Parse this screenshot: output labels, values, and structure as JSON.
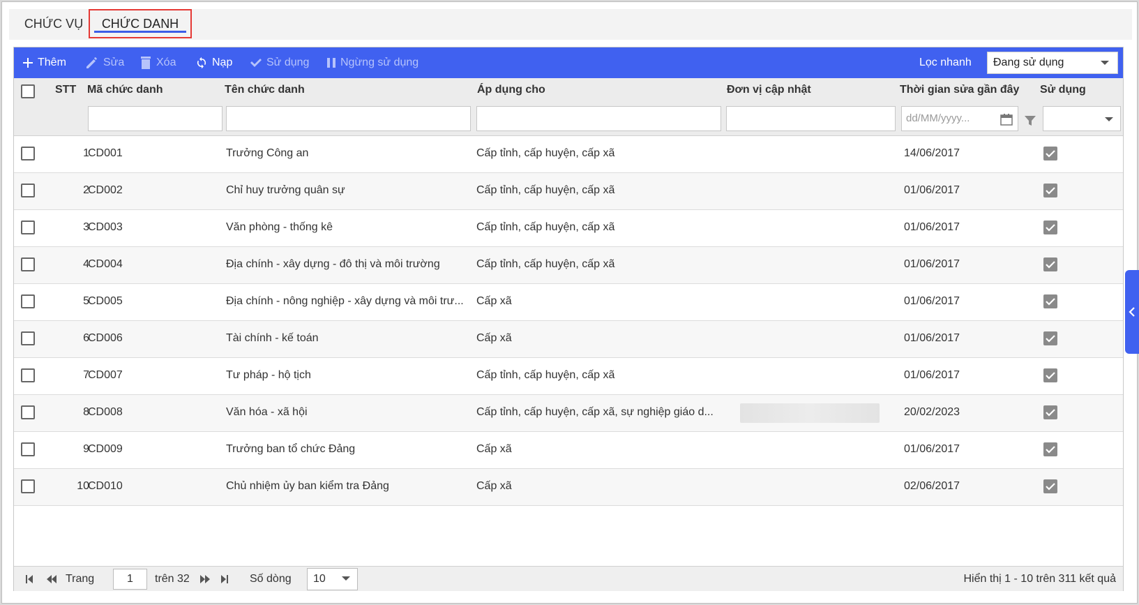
{
  "tabs": [
    {
      "label": "CHỨC VỤ"
    },
    {
      "label": "CHỨC DANH"
    }
  ],
  "toolbar": {
    "add": "Thêm",
    "edit": "Sửa",
    "delete": "Xóa",
    "reload": "Nạp",
    "use": "Sử dụng",
    "stop_use": "Ngừng sử dụng",
    "quick_filter_label": "Lọc nhanh",
    "quick_filter_value": "Đang sử dụng"
  },
  "columns": {
    "stt": "STT",
    "code": "Mã chức danh",
    "name": "Tên chức danh",
    "apply": "Áp dụng cho",
    "unit": "Đơn vị cập nhật",
    "modified": "Thời gian sửa gần đây",
    "used": "Sử dụng"
  },
  "filters": {
    "date_placeholder": "dd/MM/yyyy..."
  },
  "rows": [
    {
      "stt": "1",
      "code": "CD001",
      "name": "Trưởng Công an",
      "apply": "Cấp tỉnh, cấp huyện, cấp xã",
      "modified": "14/06/2017"
    },
    {
      "stt": "2",
      "code": "CD002",
      "name": "Chỉ huy trưởng quân sự",
      "apply": "Cấp tỉnh, cấp huyện, cấp xã",
      "modified": "01/06/2017"
    },
    {
      "stt": "3",
      "code": "CD003",
      "name": "Văn phòng - thống kê",
      "apply": "Cấp tỉnh, cấp huyện, cấp xã",
      "modified": "01/06/2017"
    },
    {
      "stt": "4",
      "code": "CD004",
      "name": "Địa chính - xây dựng - đô thị và môi trường",
      "apply": "Cấp tỉnh, cấp huyện, cấp xã",
      "modified": "01/06/2017"
    },
    {
      "stt": "5",
      "code": "CD005",
      "name": "Địa chính - nông nghiệp - xây dựng và môi trư...",
      "apply": "Cấp xã",
      "modified": "01/06/2017"
    },
    {
      "stt": "6",
      "code": "CD006",
      "name": "Tài chính - kế toán",
      "apply": "Cấp xã",
      "modified": "01/06/2017"
    },
    {
      "stt": "7",
      "code": "CD007",
      "name": "Tư pháp - hộ tịch",
      "apply": "Cấp tỉnh, cấp huyện, cấp xã",
      "modified": "01/06/2017"
    },
    {
      "stt": "8",
      "code": "CD008",
      "name": "Văn hóa - xã hội",
      "apply": "Cấp tỉnh, cấp huyện, cấp xã, sự nghiệp giáo d...",
      "modified": "20/02/2023"
    },
    {
      "stt": "9",
      "code": "CD009",
      "name": "Trưởng ban tổ chức Đảng",
      "apply": "Cấp xã",
      "modified": "01/06/2017"
    },
    {
      "stt": "10",
      "code": "CD010",
      "name": "Chủ nhiệm ủy ban kiểm tra Đảng",
      "apply": "Cấp xã",
      "modified": "02/06/2017"
    }
  ],
  "pagination": {
    "page_label": "Trang",
    "page_value": "1",
    "of_label": "trên 32",
    "rows_label": "Số dòng",
    "rows_value": "10",
    "summary": "Hiển thị 1 - 10 trên 311 kết quả"
  },
  "colors": {
    "toolbar": "#4061f0",
    "highlight": "#e53935"
  }
}
